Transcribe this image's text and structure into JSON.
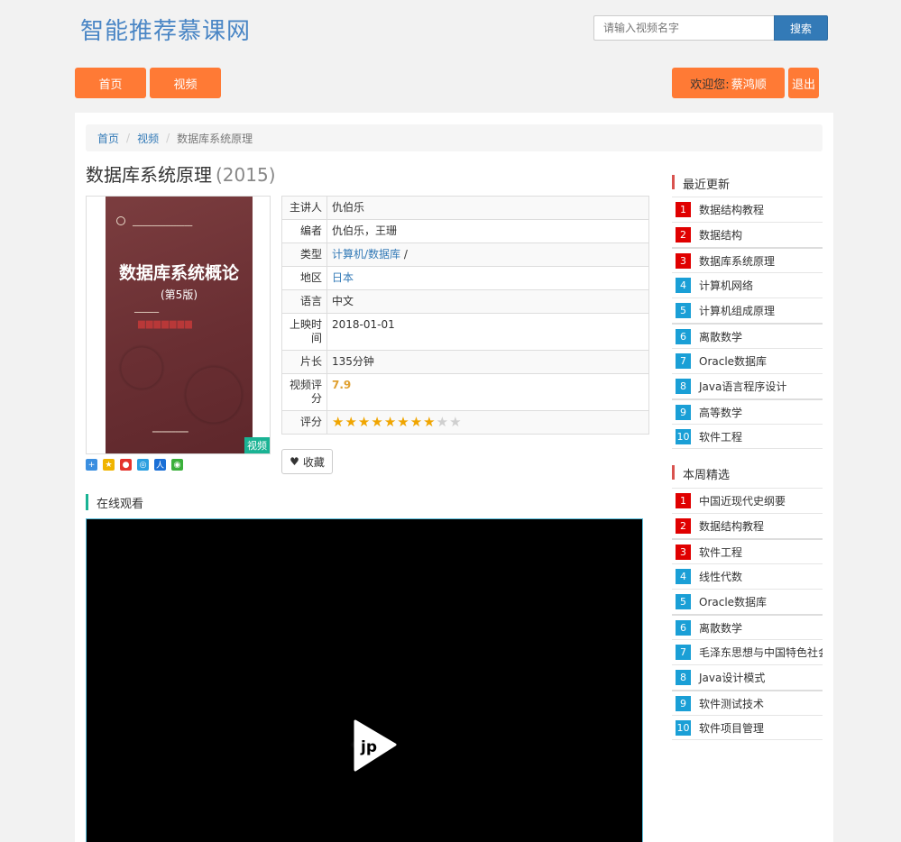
{
  "site": {
    "title": "智能推荐慕课网"
  },
  "search": {
    "placeholder": "请输入视频名字",
    "button": "搜索"
  },
  "nav": {
    "home": "首页",
    "video": "视频",
    "welcome_prefix": "欢迎您:",
    "username": "蔡鸿顺",
    "logout": "退出"
  },
  "breadcrumb": {
    "home": "首页",
    "video": "视频",
    "current": "数据库系统原理"
  },
  "course": {
    "title": "数据库系统原理",
    "year": "(2015)",
    "cover": {
      "book_title": "数据库系统概论",
      "edition": "(第5版)",
      "tag": "视频"
    },
    "info": [
      {
        "key": "主讲人",
        "value": "仇伯乐"
      },
      {
        "key": "编者",
        "value": "仇伯乐，王珊"
      },
      {
        "key": "类型",
        "value": "计算机/数据库",
        "suffix": " /"
      },
      {
        "key": "地区",
        "value": "日本"
      },
      {
        "key": "语言",
        "value": "中文"
      },
      {
        "key": "上映时间",
        "value": "2018-01-01"
      },
      {
        "key": "片长",
        "value": "135分钟"
      },
      {
        "key": "视频评分",
        "value": "7.9"
      },
      {
        "key": "评分",
        "stars_filled": 8,
        "stars_total": 10
      }
    ],
    "favorite_button": "收藏"
  },
  "watch": {
    "heading": "在线观看"
  },
  "sidebar": {
    "recent": {
      "heading": "最近更新",
      "items": [
        {
          "rank": "1",
          "label": "数据结构教程"
        },
        {
          "rank": "2",
          "label": "数据结构"
        },
        {
          "rank": "3",
          "label": "数据库系统原理"
        },
        {
          "rank": "4",
          "label": "计算机网络"
        },
        {
          "rank": "5",
          "label": "计算机组成原理"
        },
        {
          "rank": "6",
          "label": "离散数学"
        },
        {
          "rank": "7",
          "label": "Oracle数据库"
        },
        {
          "rank": "8",
          "label": "Java语言程序设计"
        },
        {
          "rank": "9",
          "label": "高等数学"
        },
        {
          "rank": "10",
          "label": "软件工程"
        }
      ]
    },
    "weekly": {
      "heading": "本周精选",
      "items": [
        {
          "rank": "1",
          "label": "中国近现代史纲要"
        },
        {
          "rank": "2",
          "label": "数据结构教程"
        },
        {
          "rank": "3",
          "label": "软件工程"
        },
        {
          "rank": "4",
          "label": "线性代数"
        },
        {
          "rank": "5",
          "label": "Oracle数据库"
        },
        {
          "rank": "6",
          "label": "离散数学"
        },
        {
          "rank": "7",
          "label": "毛泽东思想与中国特色社会主义"
        },
        {
          "rank": "8",
          "label": "Java设计模式"
        },
        {
          "rank": "9",
          "label": "软件测试技术"
        },
        {
          "rank": "10",
          "label": "软件项目管理"
        }
      ]
    }
  },
  "colors": {
    "accent_orange": "#ff7a35",
    "rank_top": "#e00000",
    "rank_rest": "#1a9fd6",
    "link": "#337ab7",
    "green": "#1ab394"
  }
}
